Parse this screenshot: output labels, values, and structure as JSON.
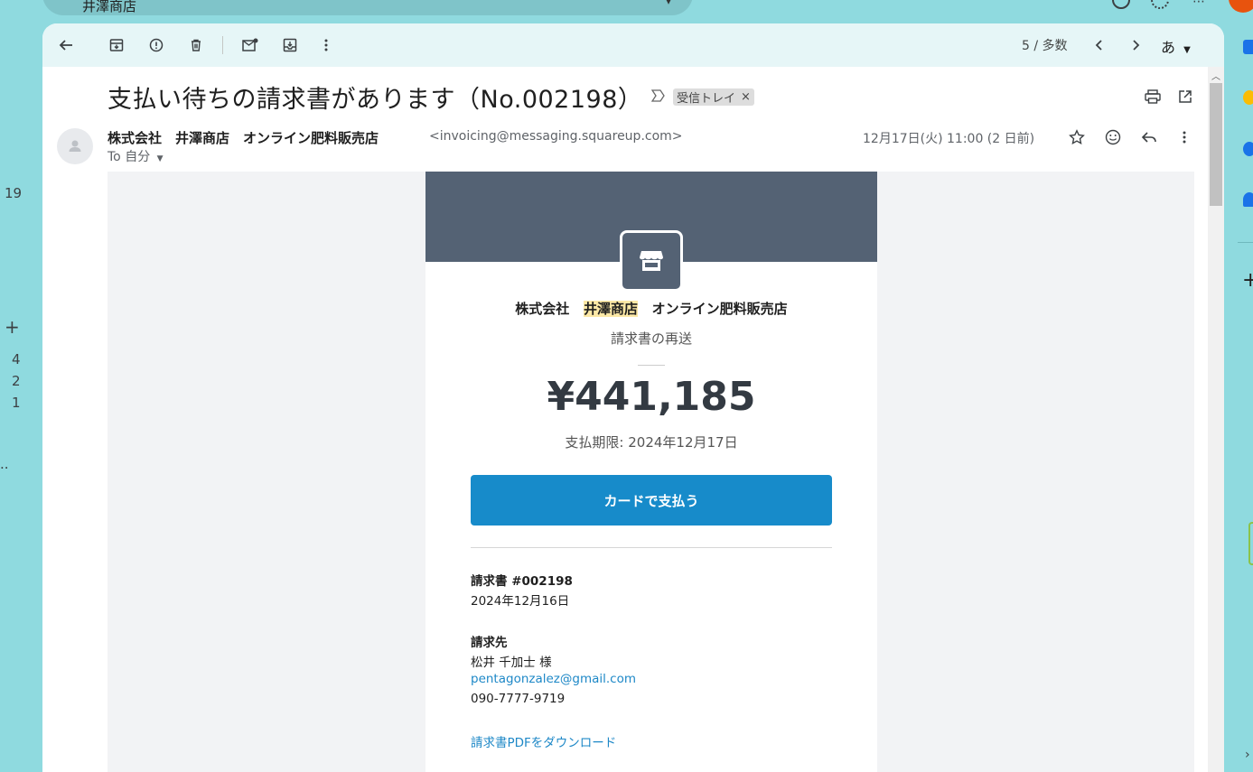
{
  "search": {
    "query": "井澤商店"
  },
  "gutter": {
    "n1": "19",
    "plus": "+",
    "n2": "4",
    "n3": "2",
    "n4": "1",
    "dots": ".."
  },
  "toolbar": {
    "pager_text": "5 / 多数",
    "lang_label": "あ"
  },
  "message": {
    "subject": "支払い待ちの請求書があります（No.002198）",
    "label": "受信トレイ",
    "label_remove": "×",
    "sender_name": "株式会社　井澤商店　オンライン肥料販売店",
    "sender_email": "<invoicing@messaging.squareup.com>",
    "to_line": "To 自分",
    "date": "12月17日(火) 11:00 (2 日前)"
  },
  "invoice": {
    "biz_prefix": "株式会社",
    "biz_highlight": "井澤商店",
    "biz_suffix": "オンライン肥料販売店",
    "resend": "請求書の再送",
    "amount": "¥441,185",
    "due": "支払期限: 2024年12月17日",
    "pay_button": "カードで支払う",
    "invoice_no_label": "請求書 #002198",
    "invoice_date": "2024年12月16日",
    "bill_to_label": "請求先",
    "bill_to_name": "松井 千加士 様",
    "bill_to_email": "pentagonzalez@gmail.com",
    "bill_to_phone": "090-7777-9719",
    "pdf_link": "請求書PDFをダウンロード"
  },
  "side_plus": "+"
}
